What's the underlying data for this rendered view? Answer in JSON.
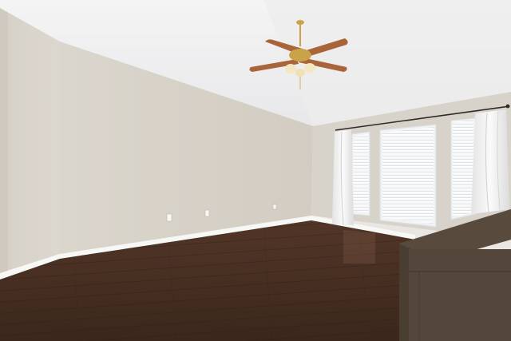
{
  "scene": {
    "kind": "empty room interior",
    "colors": {
      "ceiling": "#f2f2f3",
      "wall": "#dcd7cf",
      "wall_shadow": "#cdc7bd",
      "trim": "#f7f7f5",
      "floor": "#4a3124",
      "floor_dark": "#3a261c",
      "curtain": "#f4f4f4",
      "blind": "#f7f8fa",
      "cabinet": "#54463a",
      "fan_brass": "#c9a24a",
      "fan_blade": "#a9643a"
    },
    "objects": [
      "ceiling-fan-with-lights",
      "window-left-with-blinds",
      "window-center-with-blinds",
      "window-right-with-blinds",
      "curtain-panel",
      "curtain-rod",
      "baseboard",
      "wall-outlet",
      "hardwood-floor",
      "dresser"
    ]
  }
}
